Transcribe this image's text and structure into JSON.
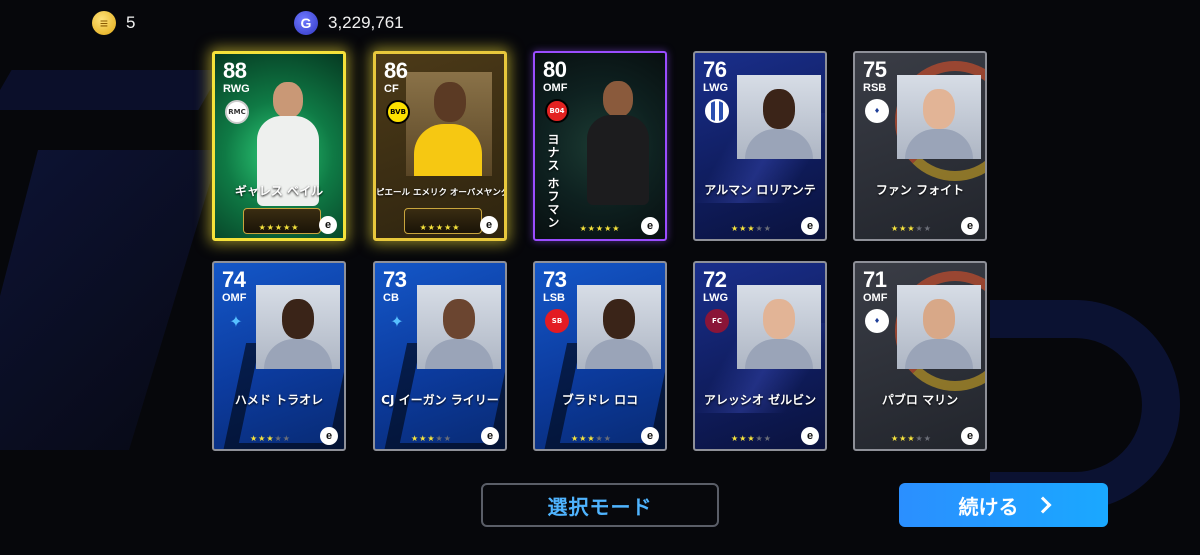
{
  "currency": {
    "coins": "5",
    "gp": "3,229,761",
    "coin_icon": "coin-icon",
    "gp_icon": "gp-icon",
    "gp_symbol": "G"
  },
  "cards": [
    {
      "rating": "88",
      "position": "RWG",
      "name": "ギャレス ベイル",
      "stars": 5
    },
    {
      "rating": "86",
      "position": "CF",
      "name": "ピエール エメリク オーバメヤング",
      "stars": 5
    },
    {
      "rating": "80",
      "position": "OMF",
      "name": "ヨナス ホフマン",
      "stars": 5
    },
    {
      "rating": "76",
      "position": "LWG",
      "name": "アルマン ロリアンテ",
      "stars": 3
    },
    {
      "rating": "75",
      "position": "RSB",
      "name": "ファン フォイト",
      "stars": 3
    },
    {
      "rating": "74",
      "position": "OMF",
      "name": "ハメド トラオレ",
      "stars": 3
    },
    {
      "rating": "73",
      "position": "CB",
      "name": "CJ イーガン ライリー",
      "stars": 3
    },
    {
      "rating": "73",
      "position": "LSB",
      "name": "ブラドレ ロコ",
      "stars": 3
    },
    {
      "rating": "72",
      "position": "LWG",
      "name": "アレッシオ ゼルビン",
      "stars": 3
    },
    {
      "rating": "71",
      "position": "OMF",
      "name": "パブロ マリン",
      "stars": 3
    }
  ],
  "buttons": {
    "select_mode": "選択モード",
    "continue": "続ける"
  },
  "colors": {
    "accent_blue": "#2b8fff",
    "select_mode_text": "#4fb4ff",
    "selected_border": "#f5e23a",
    "star_on": "#f6e33c",
    "background": "#06070b"
  }
}
